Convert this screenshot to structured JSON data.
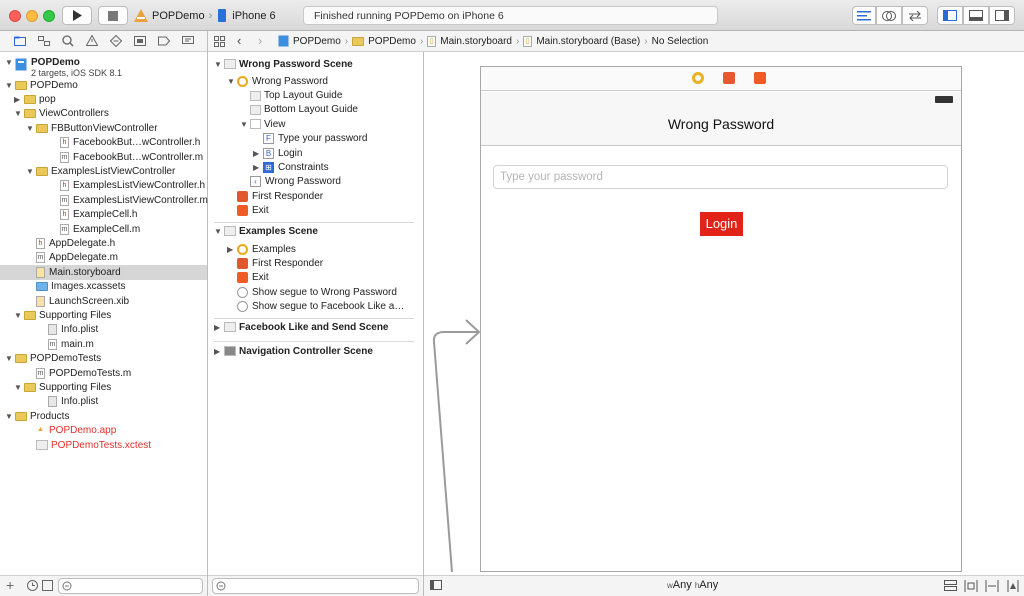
{
  "toolbar": {
    "scheme": "POPDemo",
    "device": "iPhone 6",
    "status": "Finished running POPDemo on iPhone 6"
  },
  "project": {
    "name": "POPDemo",
    "subtitle": "2 targets, iOS SDK 8.1"
  },
  "navigator_rows": [
    {
      "label": "POPDemo",
      "level": 1,
      "icon": "folder",
      "open": true
    },
    {
      "label": "pop",
      "level": 2,
      "icon": "folder",
      "open": false
    },
    {
      "label": "ViewControllers",
      "level": 2,
      "icon": "folder",
      "open": true
    },
    {
      "label": "FBButtonViewController",
      "level": 3,
      "icon": "folder",
      "open": true
    },
    {
      "label": "FacebookBut…wController.h",
      "level": 5,
      "icon": "h-file"
    },
    {
      "label": "FacebookBut…wController.m",
      "level": 5,
      "icon": "m-file"
    },
    {
      "label": "ExamplesListViewController",
      "level": 3,
      "icon": "folder",
      "open": true
    },
    {
      "label": "ExamplesListViewController.h",
      "level": 5,
      "icon": "h-file"
    },
    {
      "label": "ExamplesListViewController.m",
      "level": 5,
      "icon": "m-file"
    },
    {
      "label": "ExampleCell.h",
      "level": 5,
      "icon": "h-file"
    },
    {
      "label": "ExampleCell.m",
      "level": 5,
      "icon": "m-file"
    },
    {
      "label": "AppDelegate.h",
      "level": 3,
      "icon": "h-file"
    },
    {
      "label": "AppDelegate.m",
      "level": 3,
      "icon": "m-file"
    },
    {
      "label": "Main.storyboard",
      "level": 3,
      "icon": "storyboard-file",
      "selected": true
    },
    {
      "label": "Images.xcassets",
      "level": 3,
      "icon": "assets-folder"
    },
    {
      "label": "LaunchScreen.xib",
      "level": 3,
      "icon": "xib-file"
    },
    {
      "label": "Supporting Files",
      "level": 2,
      "icon": "folder",
      "open": true
    },
    {
      "label": "Info.plist",
      "level": 4,
      "icon": "plist-file"
    },
    {
      "label": "main.m",
      "level": 4,
      "icon": "m-file"
    },
    {
      "label": "POPDemoTests",
      "level": 1,
      "icon": "folder",
      "open": true
    },
    {
      "label": "POPDemoTests.m",
      "level": 3,
      "icon": "m-file"
    },
    {
      "label": "Supporting Files",
      "level": 2,
      "icon": "folder",
      "open": true
    },
    {
      "label": "Info.plist",
      "level": 4,
      "icon": "plist-file"
    },
    {
      "label": "Products",
      "level": 1,
      "icon": "folder",
      "open": true
    },
    {
      "label": "POPDemo.app",
      "level": 3,
      "icon": "app-file",
      "red": true
    },
    {
      "label": "POPDemoTests.xctest",
      "level": 3,
      "icon": "test-file",
      "red": true
    }
  ],
  "jumpbar": [
    "POPDemo",
    "POPDemo",
    "Main.storyboard",
    "Main.storyboard (Base)",
    "No Selection"
  ],
  "outline": {
    "scene1": {
      "title": "Wrong Password Scene",
      "controller": "Wrong Password",
      "items": [
        "Top Layout Guide",
        "Bottom Layout Guide",
        "View",
        "Type your password",
        "Login",
        "Constraints",
        "Wrong Password",
        "First Responder",
        "Exit"
      ]
    },
    "scene2": {
      "title": "Examples Scene",
      "items": [
        "Examples",
        "First Responder",
        "Exit",
        "Show segue to Wrong Password",
        "Show segue to Facebook Like a…"
      ]
    },
    "scene3": {
      "title": "Facebook Like and Send Scene"
    },
    "scene4": {
      "title": "Navigation Controller Scene"
    }
  },
  "canvas": {
    "nav_title": "Wrong Password",
    "field_placeholder": "Type your password",
    "button_label": "Login",
    "size_class_w": "Any",
    "size_class_h": "Any",
    "w_prefix": "w",
    "h_prefix": "h"
  },
  "colors": {
    "login_button": "#e2231a",
    "selection": "#d6d6d6"
  }
}
